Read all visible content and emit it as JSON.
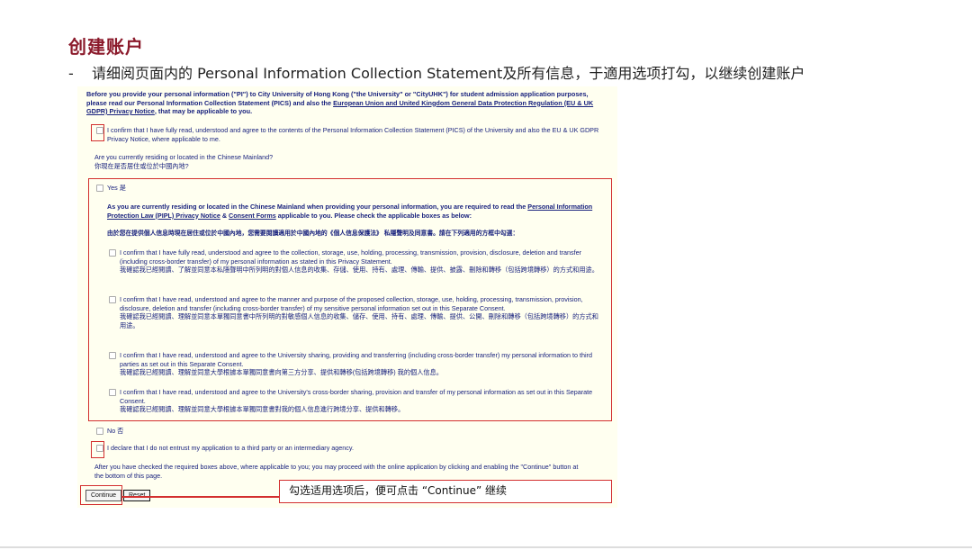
{
  "slide": {
    "title": "创建账户",
    "subtitle_dash": "-",
    "subtitle": "请细阅页面内的 Personal Information Collection Statement及所有信息，于適用选项打勾，以继续创建账户"
  },
  "form": {
    "intro_1": "Before you provide your personal information (\"PI\") to City University of Hong Kong (\"the University\" or \"CityUHK\") for student admission application purposes, please read our Personal Information Collection Statement (PICS) and also the ",
    "intro_link": "European Union and United Kingdom General Data Protection Regulation (EU & UK GDPR) Privacy Notice",
    "intro_2": ", that may be applicable to you.",
    "confirm_pics": "I confirm that I have fully read, understood and agree to the contents of the Personal Information Collection Statement (PICS) of the University and also the EU & UK GDPR Privacy Notice, where applicable to me.",
    "question_en": "Are you currently residing or located in the Chinese Mainland?",
    "question_zh": "你現在是否居住或位於中國內地?",
    "yes_label": "Yes 是",
    "pipl_en_1": "As you are currently residing or located in the Chinese Mainland when providing your personal information, you are required to read the ",
    "pipl_link_1": "Personal Information Protection Law (PIPL) Privacy Notice",
    "pipl_amp": " & ",
    "pipl_link_2": "Consent Forms",
    "pipl_en_2": " applicable to you. Please check the applicable boxes as below:",
    "pipl_zh": "由於您在提供個人信息時現在居住或位於中國內地，您需要閱讀適用於中國內地的《個人信息保護法》 私隱聲明及同意書。請在下列適用的方框中勾選：",
    "consent_items": [
      {
        "en": "I confirm that I have fully read, understood and agree to the collection, storage, use, holding, processing, transmission, provision, disclosure, deletion and transfer (including cross-border transfer) of my personal information as stated in this Privacy Statement.",
        "zh": "我確認我已經閱讀、了解並同意本私隱聲明中所列明的對個人信息的收集、存儲、使用、持有、處理、傳輸、提供、披露、刪除和轉移（包括跨境轉移）的方式和用途。"
      },
      {
        "en": "I confirm that I have read, understood and agree to the manner and purpose of the proposed collection, storage, use, holding, processing, transmission, provision, disclosure, deletion and transfer (including cross-border transfer) of my sensitive personal information set out in this Separate Consent.",
        "zh": "我確認我已經閱讀、理解並同意本單獨同意書中所列明的對敏感個人信息的收集、儲存、使用、持有、處理、傳輸、提供、公開、刪除和轉移（包括跨境轉移）的方式和用途。"
      },
      {
        "en": "I confirm that I have read, understood and agree to the University sharing, providing and transferring (including cross-border transfer) my personal information to third parties as set out in this Separate Consent.",
        "zh": "我確認我已經閱讀、理解並同意大學根據本單獨同意書向第三方分享、提供和轉移(包括跨境轉移) 我的個人信息。"
      },
      {
        "en": "I confirm that I have read, understood and agree to the University's cross-border sharing, provision and transfer of my personal information as set out in this Separate Consent.",
        "zh": "我確認我已經閱讀、理解並同意大學根據本單獨同意書對我的個人信息進行跨境分享、提供和轉移。"
      }
    ],
    "no_label": "No 否",
    "declare": "I declare that I do not entrust my application to a third party or an intermediary agency.",
    "after_note": "After you have checked the required boxes above, where applicable to you; you may proceed with the online application by clicking and enabling the \"Continue\" button at the bottom of this page.",
    "continue_label": "Continue",
    "reset_label": "Reset"
  },
  "callout": {
    "text": "勾选适用选项后，便可点击 “Continue” 继续"
  }
}
